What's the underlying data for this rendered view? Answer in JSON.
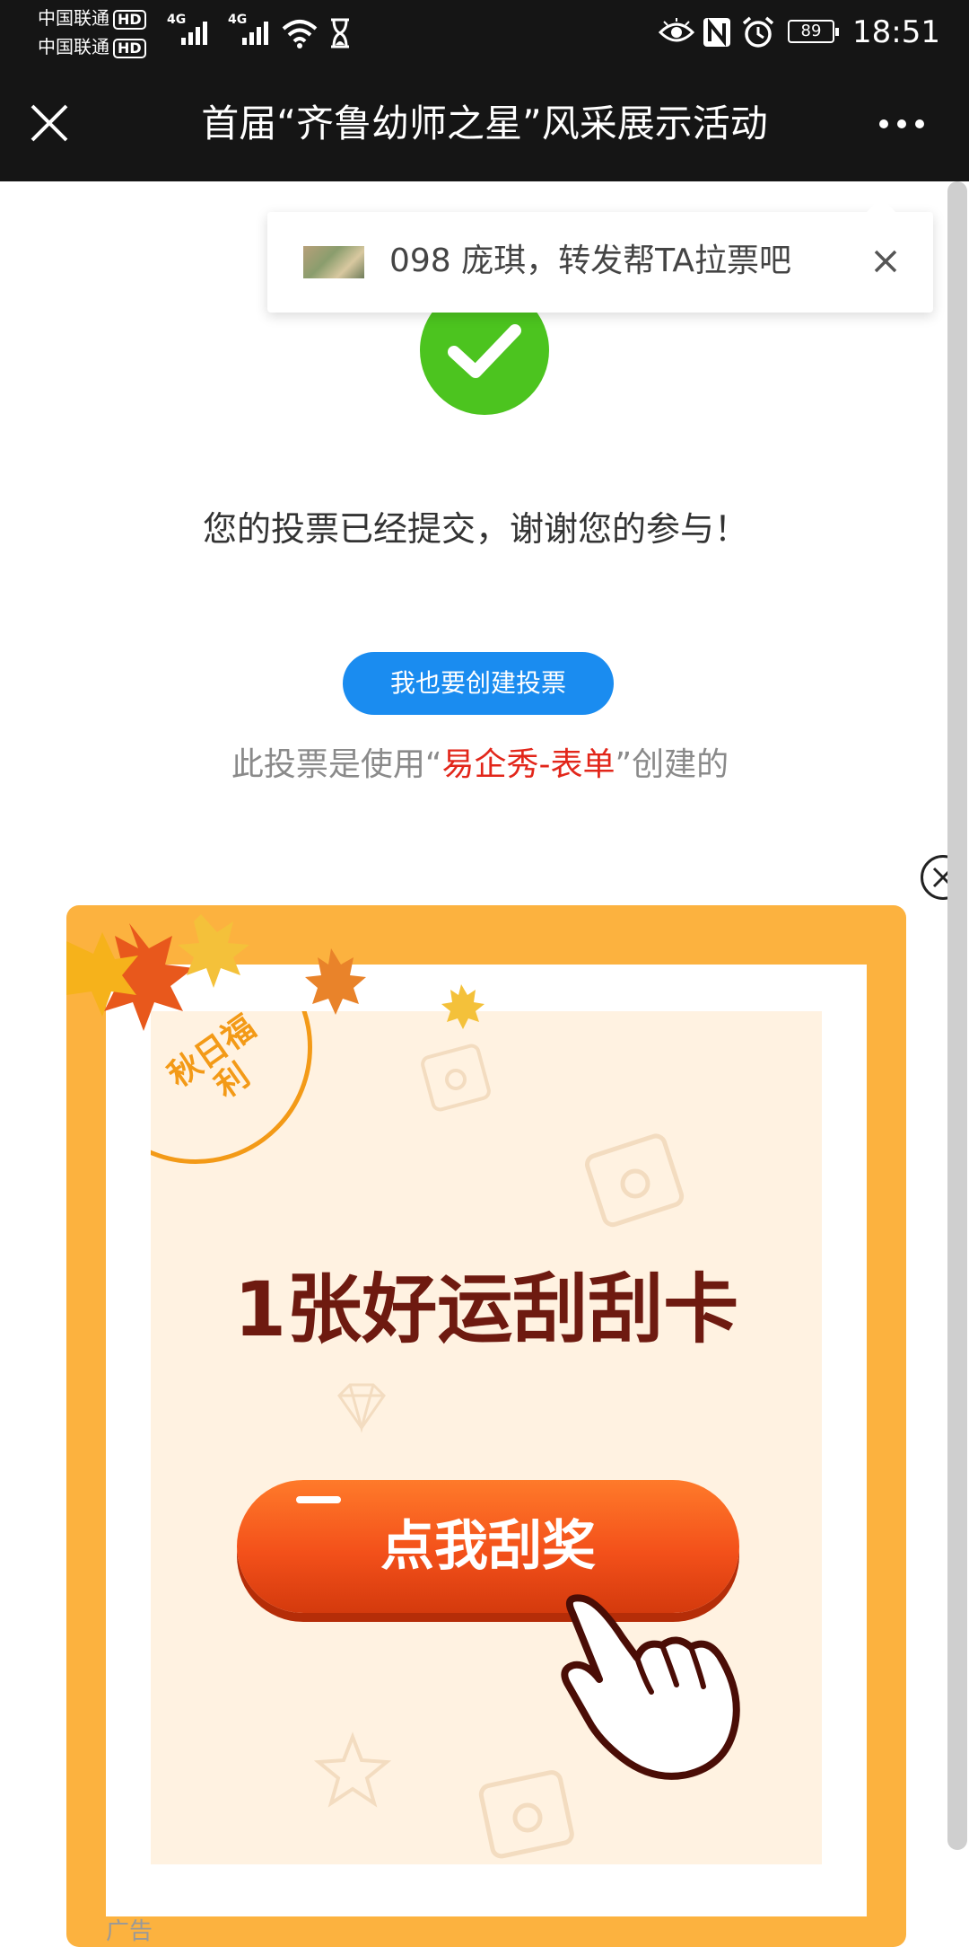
{
  "status_bar": {
    "carrier_1": "中国联通",
    "carrier_2": "中国联通",
    "hd_label": "HD",
    "network_1": "4G",
    "network_2": "4G",
    "battery": "89",
    "time": "18:51",
    "icons": [
      "signal-icon",
      "wifi-icon",
      "hourglass-icon",
      "eye-icon",
      "nfc-icon",
      "alarm-icon",
      "battery-icon"
    ]
  },
  "header": {
    "title": "首届“齐鲁幼师之星”风采展示活动"
  },
  "toast": {
    "text": "098 庞琪，转发帮TA拉票吧"
  },
  "main": {
    "thanks": "您的投票已经提交，谢谢您的参与！",
    "create_button": "我也要创建投票",
    "powered_prefix": "此投票是使用“",
    "powered_brand": "易企秀-表单",
    "powered_suffix": "”创建的"
  },
  "ad": {
    "badge": "秋日福利",
    "headline": "1张好运刮刮卡",
    "button": "点我刮奖",
    "label": "广告"
  },
  "colors": {
    "header_bg": "#151515",
    "success_green": "#4cc41f",
    "button_blue": "#1a8cf0",
    "brand_red": "#e2261a",
    "ad_orange": "#fcb23f",
    "ad_button": "#f3501a"
  }
}
